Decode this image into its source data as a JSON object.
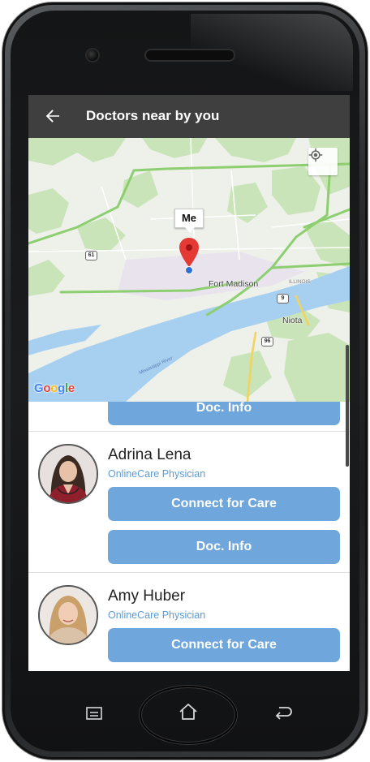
{
  "appbar": {
    "title": "Doctors near by you",
    "back_icon": "arrow-left-icon"
  },
  "map": {
    "me_label": "Me",
    "places": [
      "Fort Madison",
      "Niota"
    ],
    "state_label": "ILLINOIS",
    "river_label": "Mississippi River",
    "route_shields": [
      "61",
      "9",
      "96"
    ],
    "attribution": "Google",
    "locate_icon": "my-location-icon",
    "colors": {
      "water": "#a6cff0",
      "land": "#eef0ea",
      "park": "#c9e4b8",
      "highway": "#8dcf70",
      "pin": "#e53935"
    }
  },
  "list": {
    "partial_card": {
      "info_button": "Doc. Info"
    },
    "doctors": [
      {
        "name": "Adrina Lena",
        "role": "OnlineCare Physician",
        "connect_button": "Connect for Care",
        "info_button": "Doc. Info"
      },
      {
        "name": "Amy Huber",
        "role": "OnlineCare Physician",
        "connect_button": "Connect for Care"
      }
    ],
    "button_color": "#6fa6dc"
  },
  "device_nav": {
    "menu_icon": "menu-icon",
    "home_icon": "home-icon",
    "back_icon": "back-icon"
  }
}
